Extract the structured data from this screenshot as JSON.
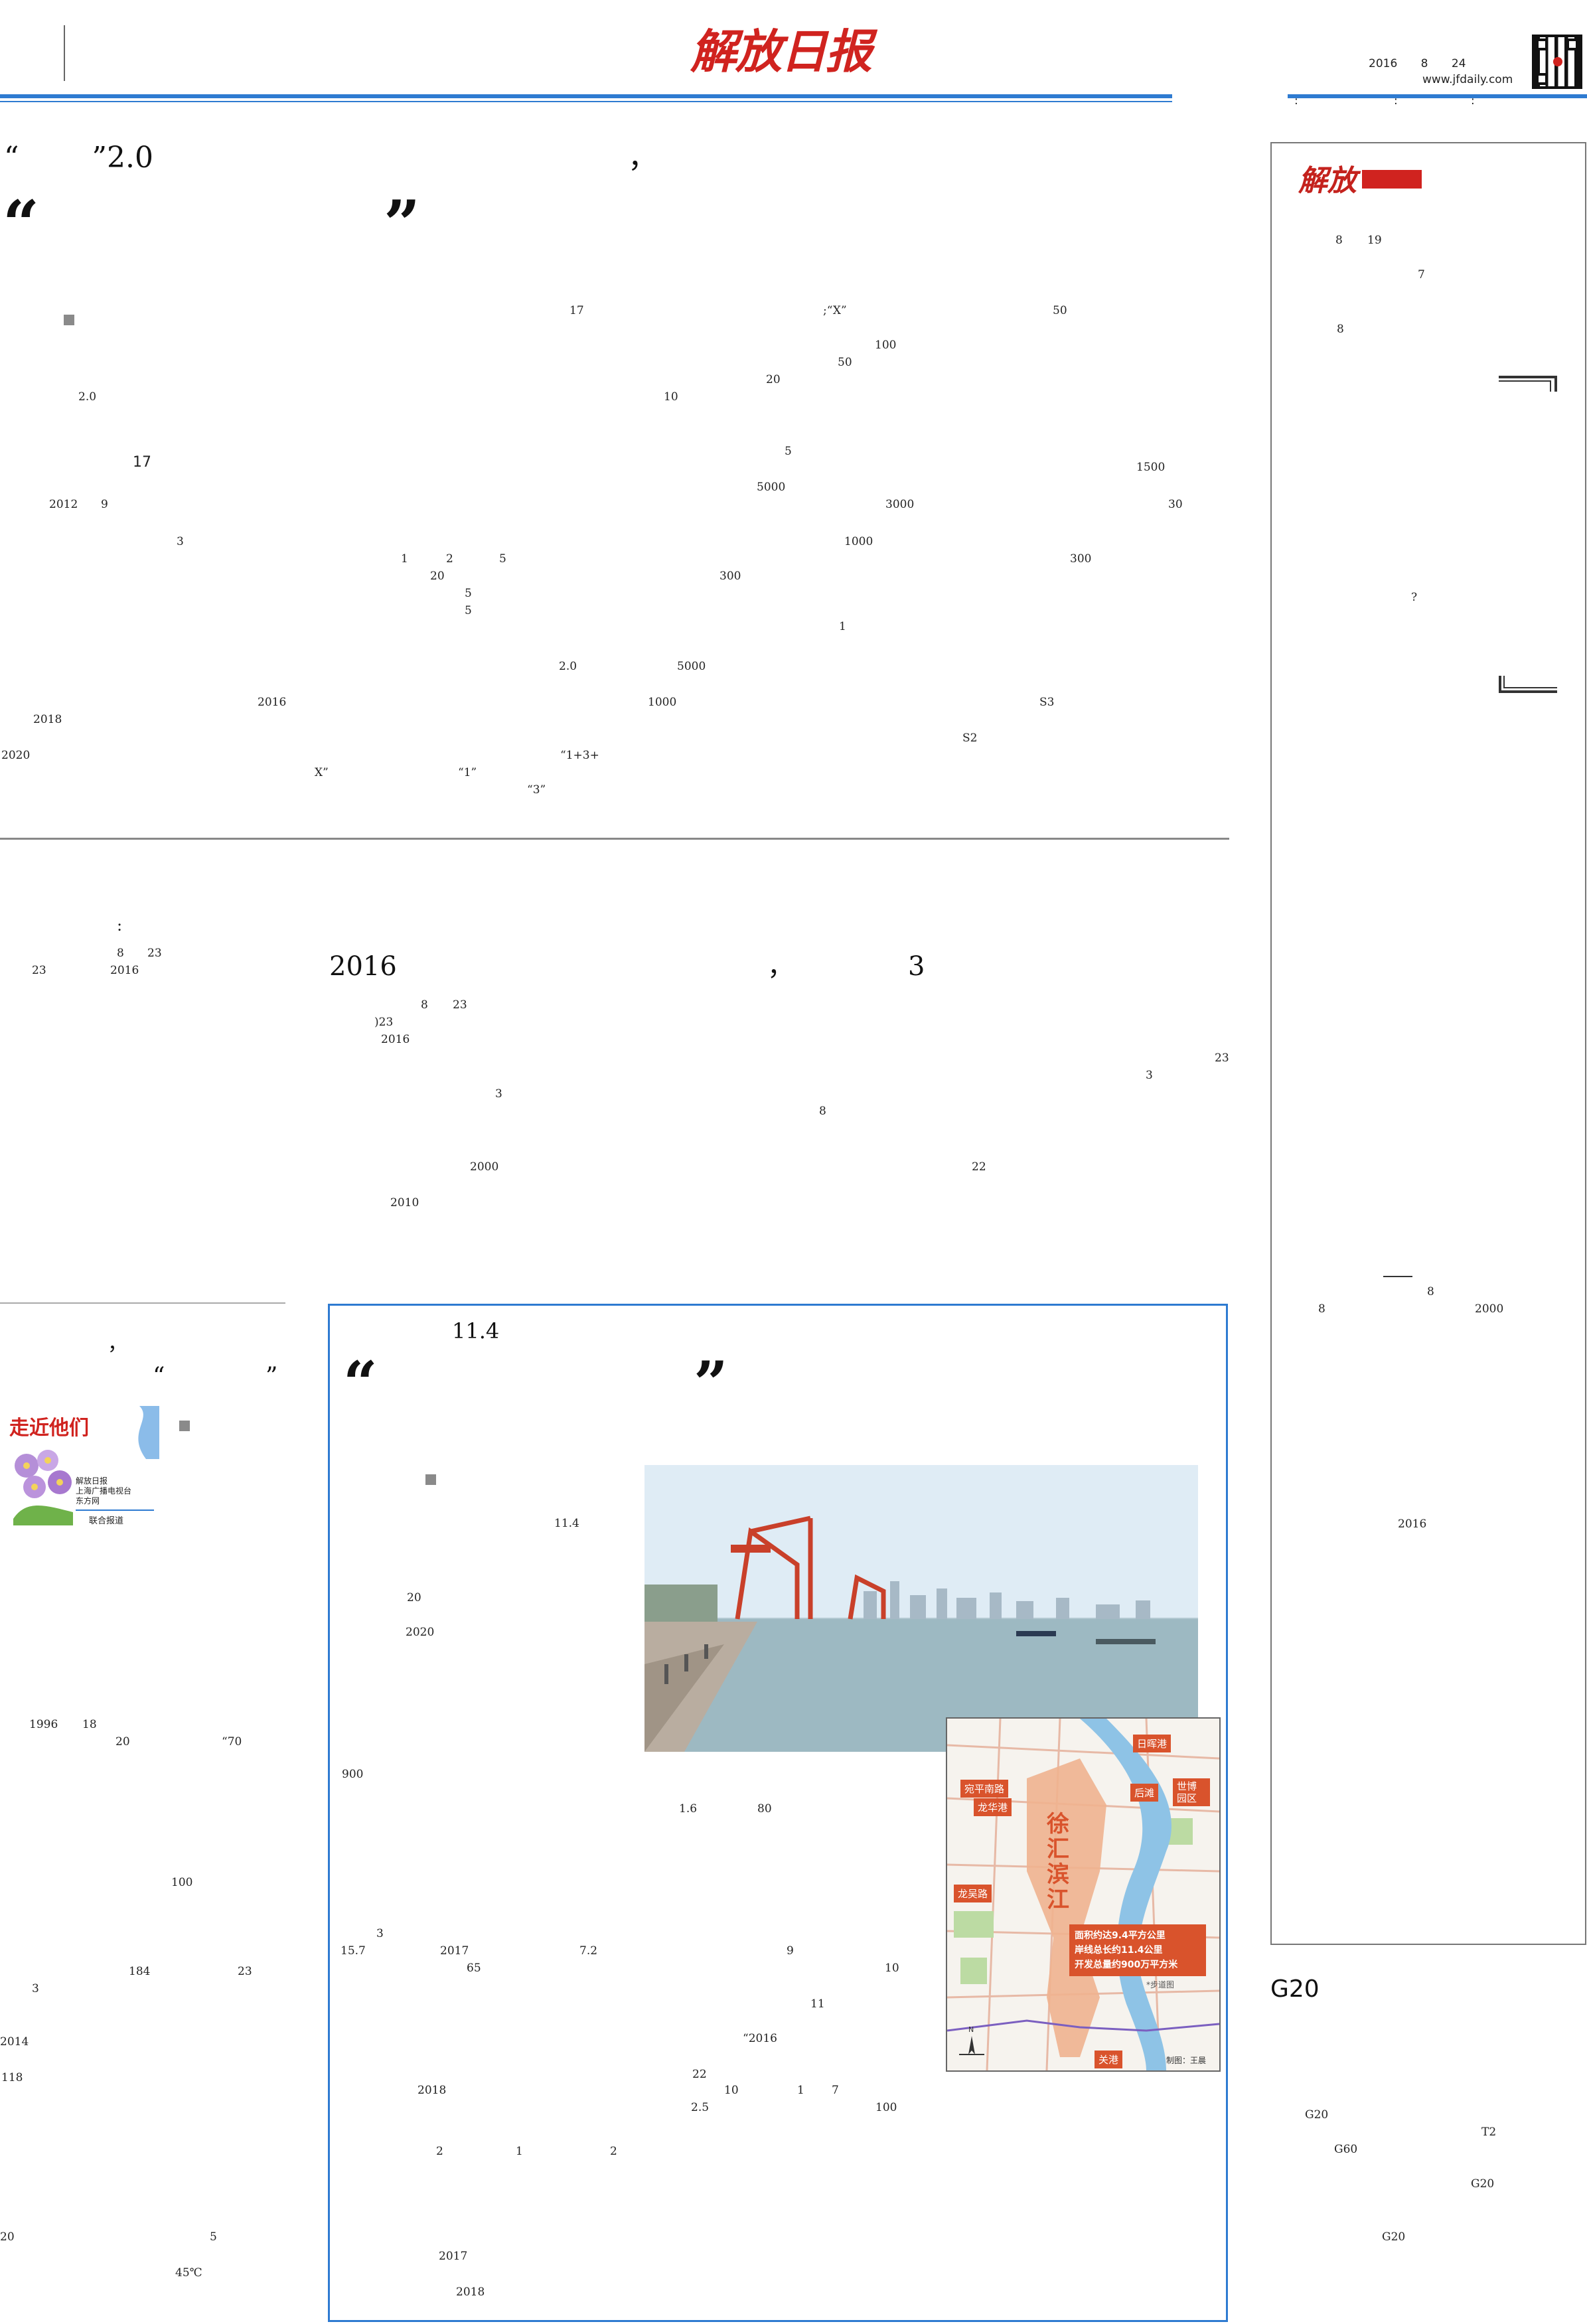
{
  "header": {
    "masthead": "解放日报",
    "date": "2016 8 24",
    "year": "2016",
    "month": "8",
    "day": "24",
    "website": "www.jfdaily.com",
    "colons": [
      ":",
      ":",
      ":"
    ],
    "colors": {
      "blue_rule": "#2e7bd1",
      "red": "#d0231f",
      "text": "#1a1a1a"
    }
  },
  "lead": {
    "kicker_quote_open": "“",
    "kicker_version": "”2.0",
    "kicker_comma": "，",
    "quote_open": "“",
    "quote_close": "”",
    "fragments": [
      "17",
      "50",
      "100",
      "50",
      "20",
      "10",
      "2.0",
      "17",
      "5",
      "1500",
      "5000",
      "2012",
      "9",
      "3000",
      "30",
      "3",
      "1000",
      "1",
      "2",
      "5",
      "300",
      "20",
      "300",
      "5",
      "5",
      "1",
      "2.0",
      "5000",
      "2016",
      "1000",
      "S3",
      "2018",
      "S2",
      "2020",
      "“1+3+",
      "X”",
      "“1”",
      "“3”",
      ";“X”"
    ]
  },
  "story2": {
    "headline_year": "2016",
    "headline_comma": "，",
    "headline_num": "3",
    "colon": ":",
    "fragments": [
      "8",
      "23",
      "2016",
      "23",
      "8",
      "23",
      ")23",
      "2016",
      "23",
      "3",
      "3",
      "8",
      "2000",
      "22",
      "2010"
    ]
  },
  "left_column": {
    "head_comma": "，",
    "head_quote_open": "“",
    "head_quote_close": "”",
    "badge_title": "走近他们",
    "badge_lines": [
      "解放日报",
      "上海广播电视台",
      "东方网"
    ],
    "badge_footer": "联合报道",
    "fragments": [
      "1996",
      "18",
      "20",
      "“70",
      "100",
      "184",
      "23",
      "3",
      "2014",
      "118",
      "20",
      "5",
      "45℃"
    ]
  },
  "boxed_story": {
    "kicker": "11.4",
    "quote_open": "“",
    "quote_close": "”",
    "fragments": [
      "11.4",
      "20",
      "2020",
      "900",
      "1.6",
      "80",
      "3",
      "15.7",
      "2017",
      "7.2",
      "65",
      "9",
      "10",
      "11",
      "“2016",
      "2018",
      "22",
      "10",
      "1",
      "7",
      "2.5",
      "100",
      "2",
      "1",
      "2",
      "2017",
      "2018"
    ]
  },
  "map": {
    "title": "徐汇滨江",
    "labels": [
      "日晖港",
      "宛平南路",
      "龙华港",
      "后滩",
      "世博园区",
      "龙吴路",
      "关港"
    ],
    "facts": [
      "面积约达9.4平方公里",
      "岸线总长约11.4公里",
      "开发总量约900万平方米"
    ],
    "legend": "*步道图",
    "north": "N",
    "credit": "制图：王晨"
  },
  "right_column": {
    "logo": "解放",
    "fragments": [
      "8",
      "19",
      "7",
      "8",
      "?",
      "8",
      "8",
      "2000",
      "2016"
    ],
    "bottom_title": "G20",
    "bottom_fragments": [
      "G20",
      "T2",
      "G60",
      "G20",
      "G20"
    ]
  }
}
